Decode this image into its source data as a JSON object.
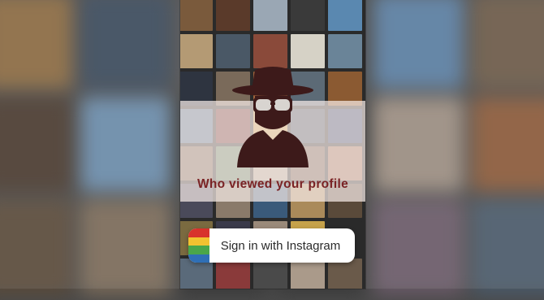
{
  "screen": {
    "headline": "Who viewed your profile",
    "signin_button": {
      "label": "Sign in with Instagram"
    }
  },
  "colors": {
    "headline": "#7a2325",
    "spy_figure": "#3d1a1a",
    "band": "#f6ece8",
    "logo_stripes": [
      "#d8322c",
      "#f2c230",
      "#4aa64a",
      "#2f6fb6"
    ]
  },
  "icons": {
    "spy": "spy-icon",
    "logo": "instagram-logo-icon"
  }
}
